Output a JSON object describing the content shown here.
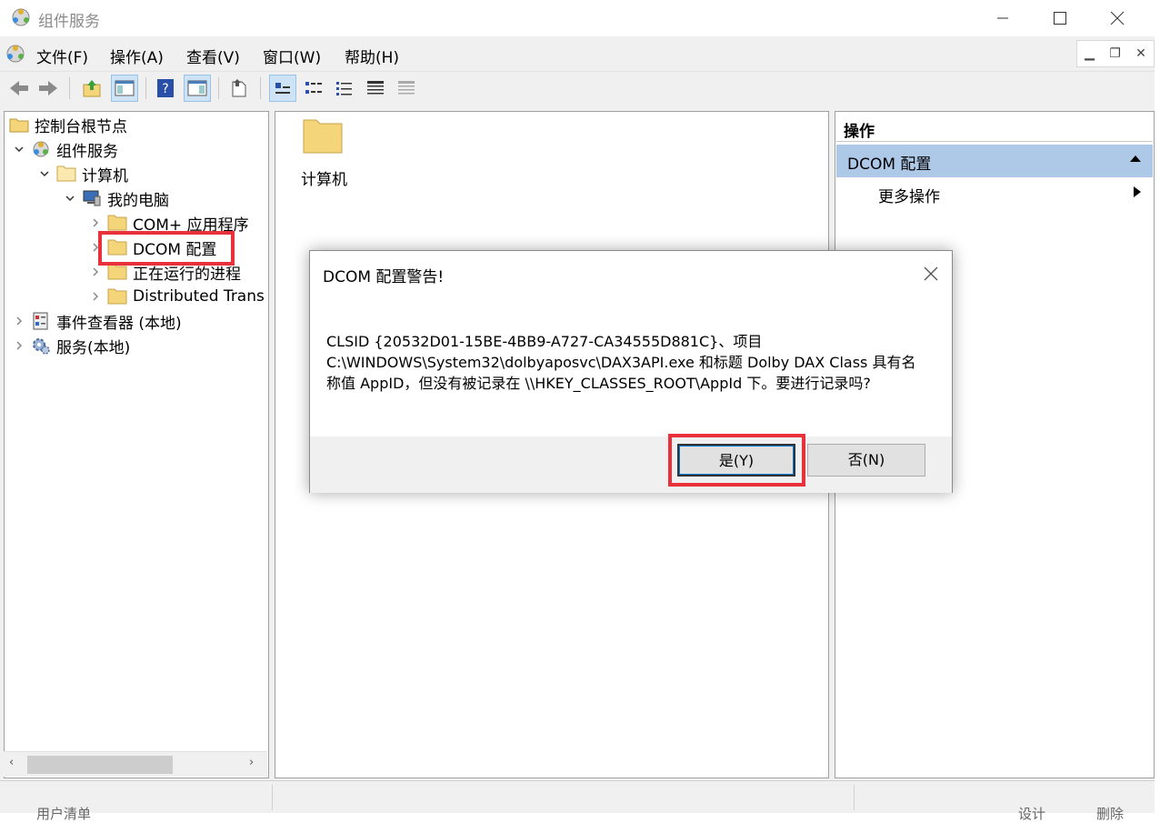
{
  "window": {
    "title": "组件服务"
  },
  "menubar": [
    "文件(F)",
    "操作(A)",
    "查看(V)",
    "窗口(W)",
    "帮助(H)"
  ],
  "toolbar": {
    "icons": [
      "back-icon",
      "forward-icon",
      "up-folder-icon",
      "show-tree-icon",
      "help-icon",
      "show-action-pane-icon",
      "export-icon",
      "large-icons-view-icon",
      "small-icons-view-icon",
      "list-view-icon",
      "detail-view-icon",
      "status-view-icon"
    ]
  },
  "tree": {
    "root": "控制台根节点",
    "component_services": "组件服务",
    "computers": "计算机",
    "my_computer": "我的电脑",
    "com_apps": "COM+ 应用程序",
    "dcom_config": "DCOM 配置",
    "running_processes": "正在运行的进程",
    "distributed": "Distributed Trans",
    "event_viewer": "事件查看器 (本地)",
    "services": "服务(本地)"
  },
  "content": {
    "items": [
      {
        "label": "计算机",
        "icon": "folder-icon"
      }
    ]
  },
  "actions": {
    "header": "操作",
    "selected": "DCOM 配置",
    "more": "更多操作"
  },
  "status": {
    "ghost_left": "用户清单",
    "ghost_right_1": "设计",
    "ghost_right_2": "删除"
  },
  "dialog": {
    "title": "DCOM 配置警告!",
    "line1": "CLSID {20532D01-15BE-4BB9-A727-CA34555D881C}、项目",
    "line2": "C:\\WINDOWS\\System32\\dolbyaposvc\\DAX3API.exe 和标题 Dolby DAX Class 具有名",
    "line3": "称值 AppID，但没有被记录在 \\\\HKEY_CLASSES_ROOT\\AppId 下。要进行记录吗?",
    "yes": "是(Y)",
    "no": "否(N)"
  },
  "colors": {
    "highlight": "#e8313a",
    "selection": "#aec9e8",
    "folder": "#f4d57a"
  }
}
